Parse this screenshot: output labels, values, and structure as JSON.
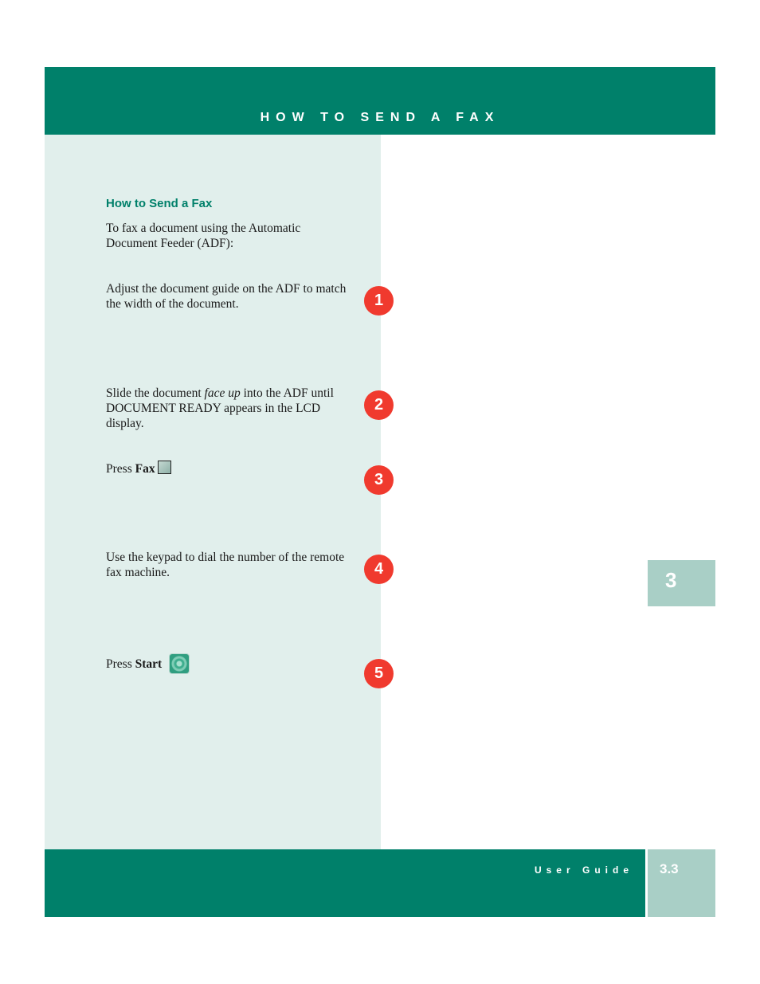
{
  "header": {
    "title": "HOW TO SEND A FAX"
  },
  "section": {
    "title": "How to Send a Fax",
    "intro": "To fax a document using the Automatic Document Feeder (ADF):"
  },
  "steps": [
    {
      "number": "1",
      "text": "Adjust the document guide on the ADF to match the width of the document."
    },
    {
      "number": "2",
      "text_before": "Slide the document ",
      "text_italic": "face up",
      "text_after": " into the ADF until DOCUMENT READY appears in the LCD display."
    },
    {
      "number": "3",
      "text": "Press ",
      "bold": "Fax",
      "icon": "fax-key-icon"
    },
    {
      "number": "4",
      "text": "Use the keypad to dial the number of the remote fax machine."
    },
    {
      "number": "5",
      "text": "Press ",
      "bold": "Start",
      "icon": "start-key-icon"
    }
  ],
  "chapter_tab": {
    "label": "3"
  },
  "footer": {
    "label": "User Guide",
    "page_number": "3.3"
  },
  "colors": {
    "brand_green": "#00806a",
    "panel_bg": "#e1efec",
    "tab_bg": "#a9cfc6",
    "badge_red": "#f03a2e"
  }
}
